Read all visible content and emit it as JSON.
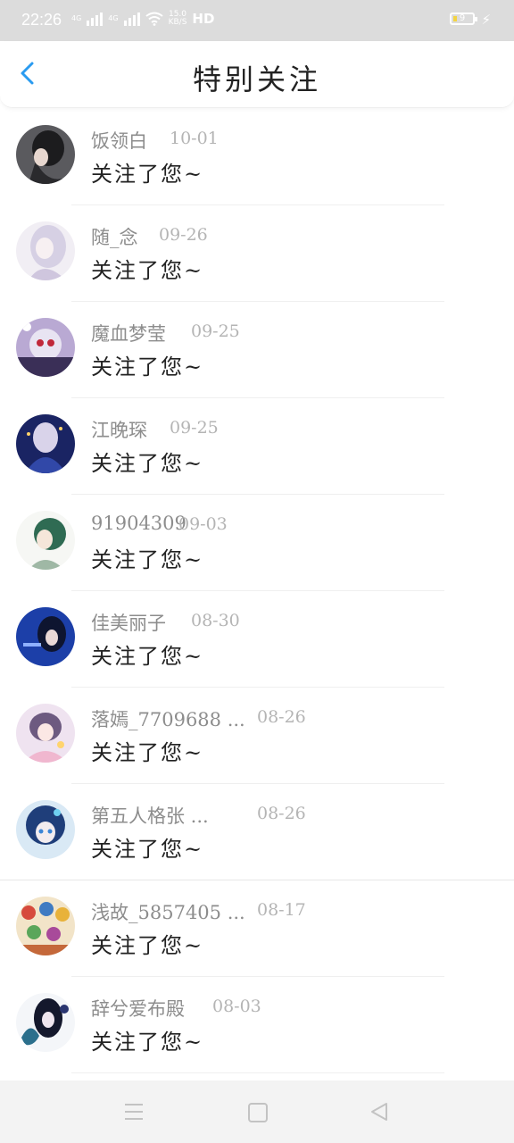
{
  "status_bar": {
    "time": "22:26",
    "net1": "4G",
    "net2": "4G",
    "speed_value": "15.0",
    "speed_unit": "KB/S",
    "hd": "HD",
    "battery": "9"
  },
  "header": {
    "title": "特别关注",
    "back_icon": "chevron-left-icon",
    "accent": "#2a9bf0"
  },
  "notifications": [
    {
      "name": "饭领白",
      "date": "10-01",
      "message": "关注了您~"
    },
    {
      "name": "随_念",
      "date": "09-26",
      "message": "关注了您~"
    },
    {
      "name": "魔血梦莹",
      "date": "09-25",
      "message": "关注了您~"
    },
    {
      "name": "江晚琛",
      "date": "09-25",
      "message": "关注了您~"
    },
    {
      "name": "91904309",
      "date": "09-03",
      "message": "关注了您~"
    },
    {
      "name": "佳美丽子",
      "date": "08-30",
      "message": "关注了您~"
    },
    {
      "name": "落嫣_7709688 ...",
      "date": "08-26",
      "message": "关注了您~"
    },
    {
      "name": "第五人格张 ...",
      "date": "08-26",
      "message": "关注了您~"
    },
    {
      "name": "浅故_5857405 ...",
      "date": "08-17",
      "message": "关注了您~"
    },
    {
      "name": "辞兮爱布殿",
      "date": "08-03",
      "message": "关注了您~"
    }
  ],
  "nav_bar": {
    "menu_icon": "menu-icon",
    "home_icon": "home-square-icon",
    "back_icon": "back-triangle-icon"
  }
}
